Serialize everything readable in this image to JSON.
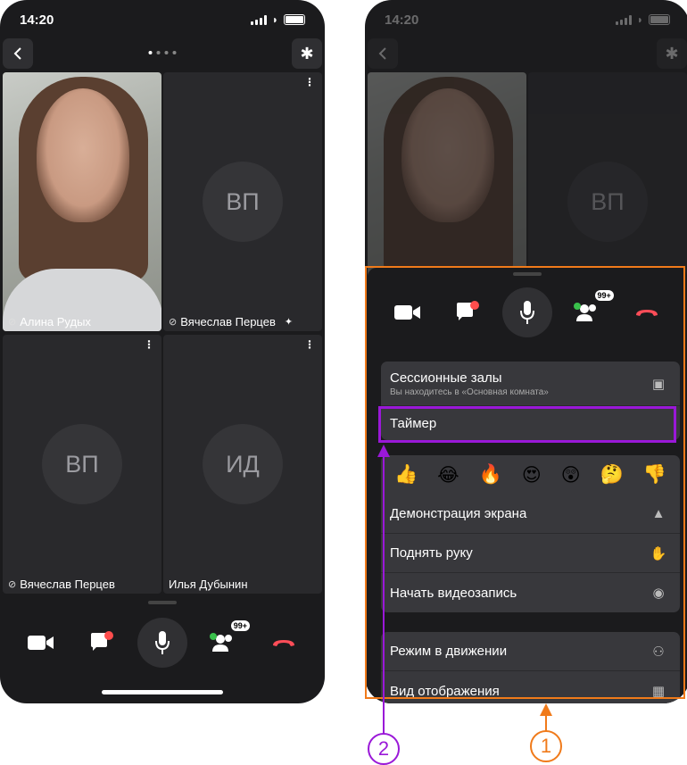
{
  "status_bar": {
    "time": "14:20"
  },
  "phone1": {
    "tiles": [
      {
        "name": "Алина Рудых",
        "type": "video"
      },
      {
        "name": "Вячеслав Перцев",
        "initials": "ВП",
        "pinned": true
      },
      {
        "name": "Вячеслав Перцев",
        "initials": "ВП"
      },
      {
        "name": "Илья Дубынин",
        "initials": "ИД"
      }
    ],
    "participants_badge": "99+"
  },
  "phone2": {
    "bg_initials": "ВП",
    "participants_badge": "99+",
    "menu": {
      "sessions_title": "Сессионные залы",
      "sessions_sub": "Вы находитесь в «Основная комната»",
      "timer": "Таймер",
      "emojis": [
        "👍",
        "😂",
        "🔥",
        "😍",
        "😲",
        "🤔",
        "👎"
      ],
      "screen_share": "Демонстрация экрана",
      "raise_hand": "Поднять руку",
      "start_recording": "Начать видеозапись",
      "motion_mode": "Режим в движении",
      "display_view": "Вид отображения"
    }
  },
  "annotations": {
    "callout1": "1",
    "callout2": "2",
    "orange_color": "#f07a1a",
    "purple_color": "#9a18d8"
  }
}
